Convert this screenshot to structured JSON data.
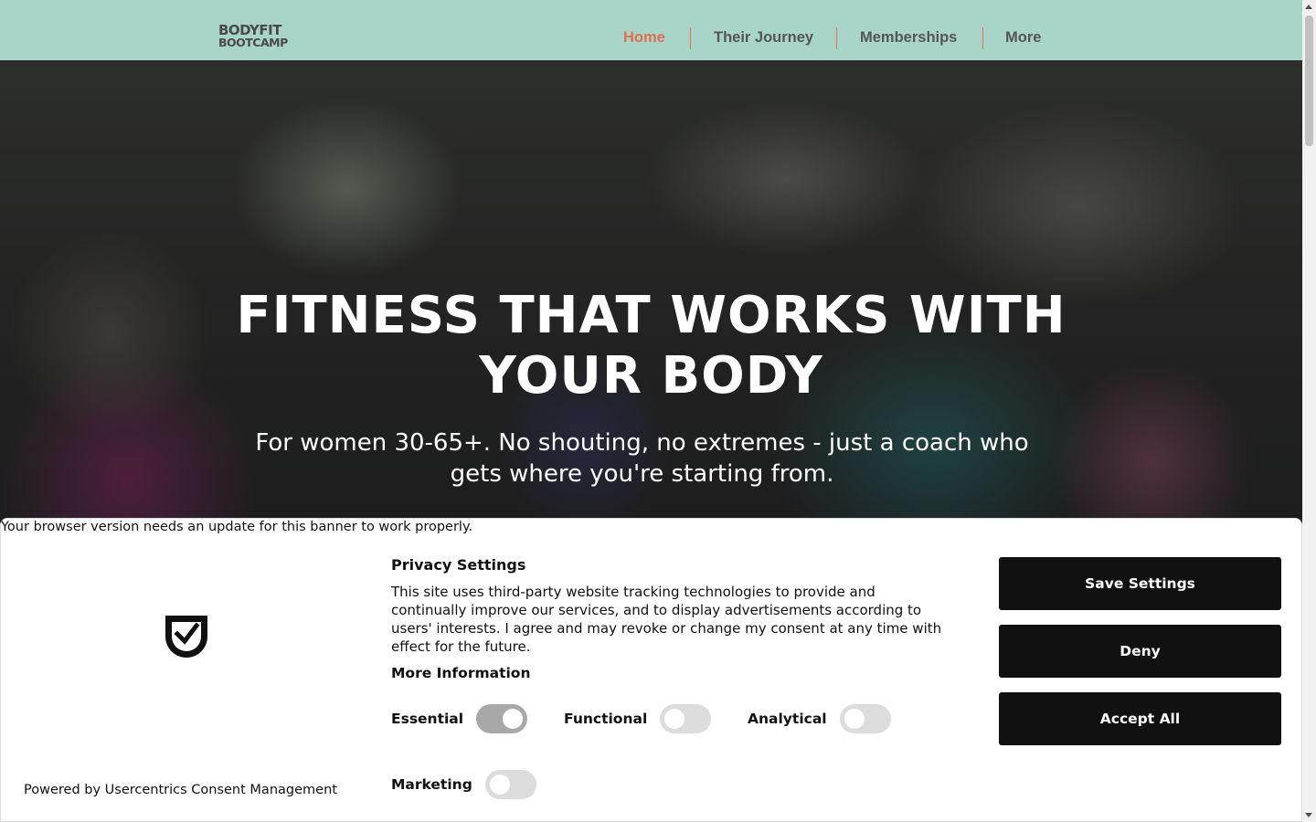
{
  "header": {
    "logo_line1": "BODYFIT",
    "logo_line2": "BOOTCAMP",
    "nav": [
      {
        "label": "Home",
        "active": true
      },
      {
        "label": "Their Journey"
      },
      {
        "label": "Memberships"
      },
      {
        "label": "More"
      }
    ],
    "colors": {
      "background": "#a9d5c9",
      "active": "#e07050",
      "text": "#555555"
    }
  },
  "hero": {
    "title": "FITNESS THAT WORKS WITH YOUR BODY",
    "subtitle": "For women 30-65+. No shouting, no extremes - just a coach who gets where you're starting from."
  },
  "consent": {
    "browser_note": "Your browser version needs an update for this banner to work properly.",
    "logo_icon": "shield-check-icon",
    "powered_by": "Powered by Usercentrics Consent Management",
    "title": "Privacy Settings",
    "description": "This site uses third-party website tracking technologies to provide and continually improve our services, and to display advertisements according to users' interests. I agree and may revoke or change my consent at any time with effect for the future.",
    "more_info": "More Information",
    "toggles": [
      {
        "label": "Essential",
        "on": true
      },
      {
        "label": "Functional",
        "on": false
      },
      {
        "label": "Analytical",
        "on": false
      },
      {
        "label": "Marketing",
        "on": false
      }
    ],
    "buttons": {
      "save": "Save Settings",
      "deny": "Deny",
      "accept": "Accept All"
    }
  }
}
